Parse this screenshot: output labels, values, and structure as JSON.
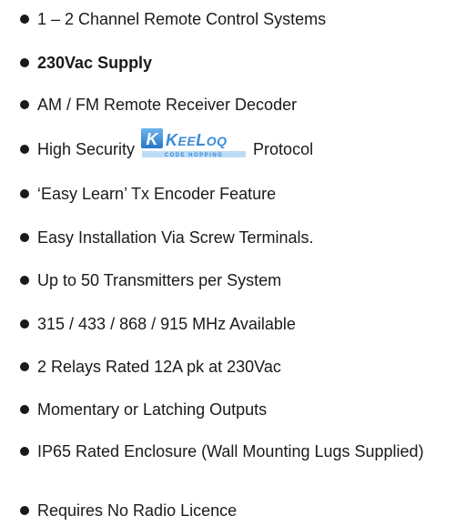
{
  "features": [
    "1 – 2 Channel Remote Control Systems",
    "230Vac Supply",
    "AM / FM  Remote Receiver Decoder",
    "High Security",
    "Protocol",
    "‘Easy Learn’ Tx Encoder Feature",
    "Easy Installation Via Screw Terminals.",
    "Up to 50 Transmitters per System",
    "315 / 433 / 868 / 915 MHz Available",
    "2 Relays Rated 12A pk at 230Vac",
    "Momentary or Latching Outputs",
    "IP65 Rated Enclosure (Wall Mounting Lugs Supplied)",
    "Requires No Radio Licence"
  ],
  "logo": {
    "name": "KEELOQ",
    "tagline": "CODE HOPPING",
    "color": "#3a8ad8"
  }
}
